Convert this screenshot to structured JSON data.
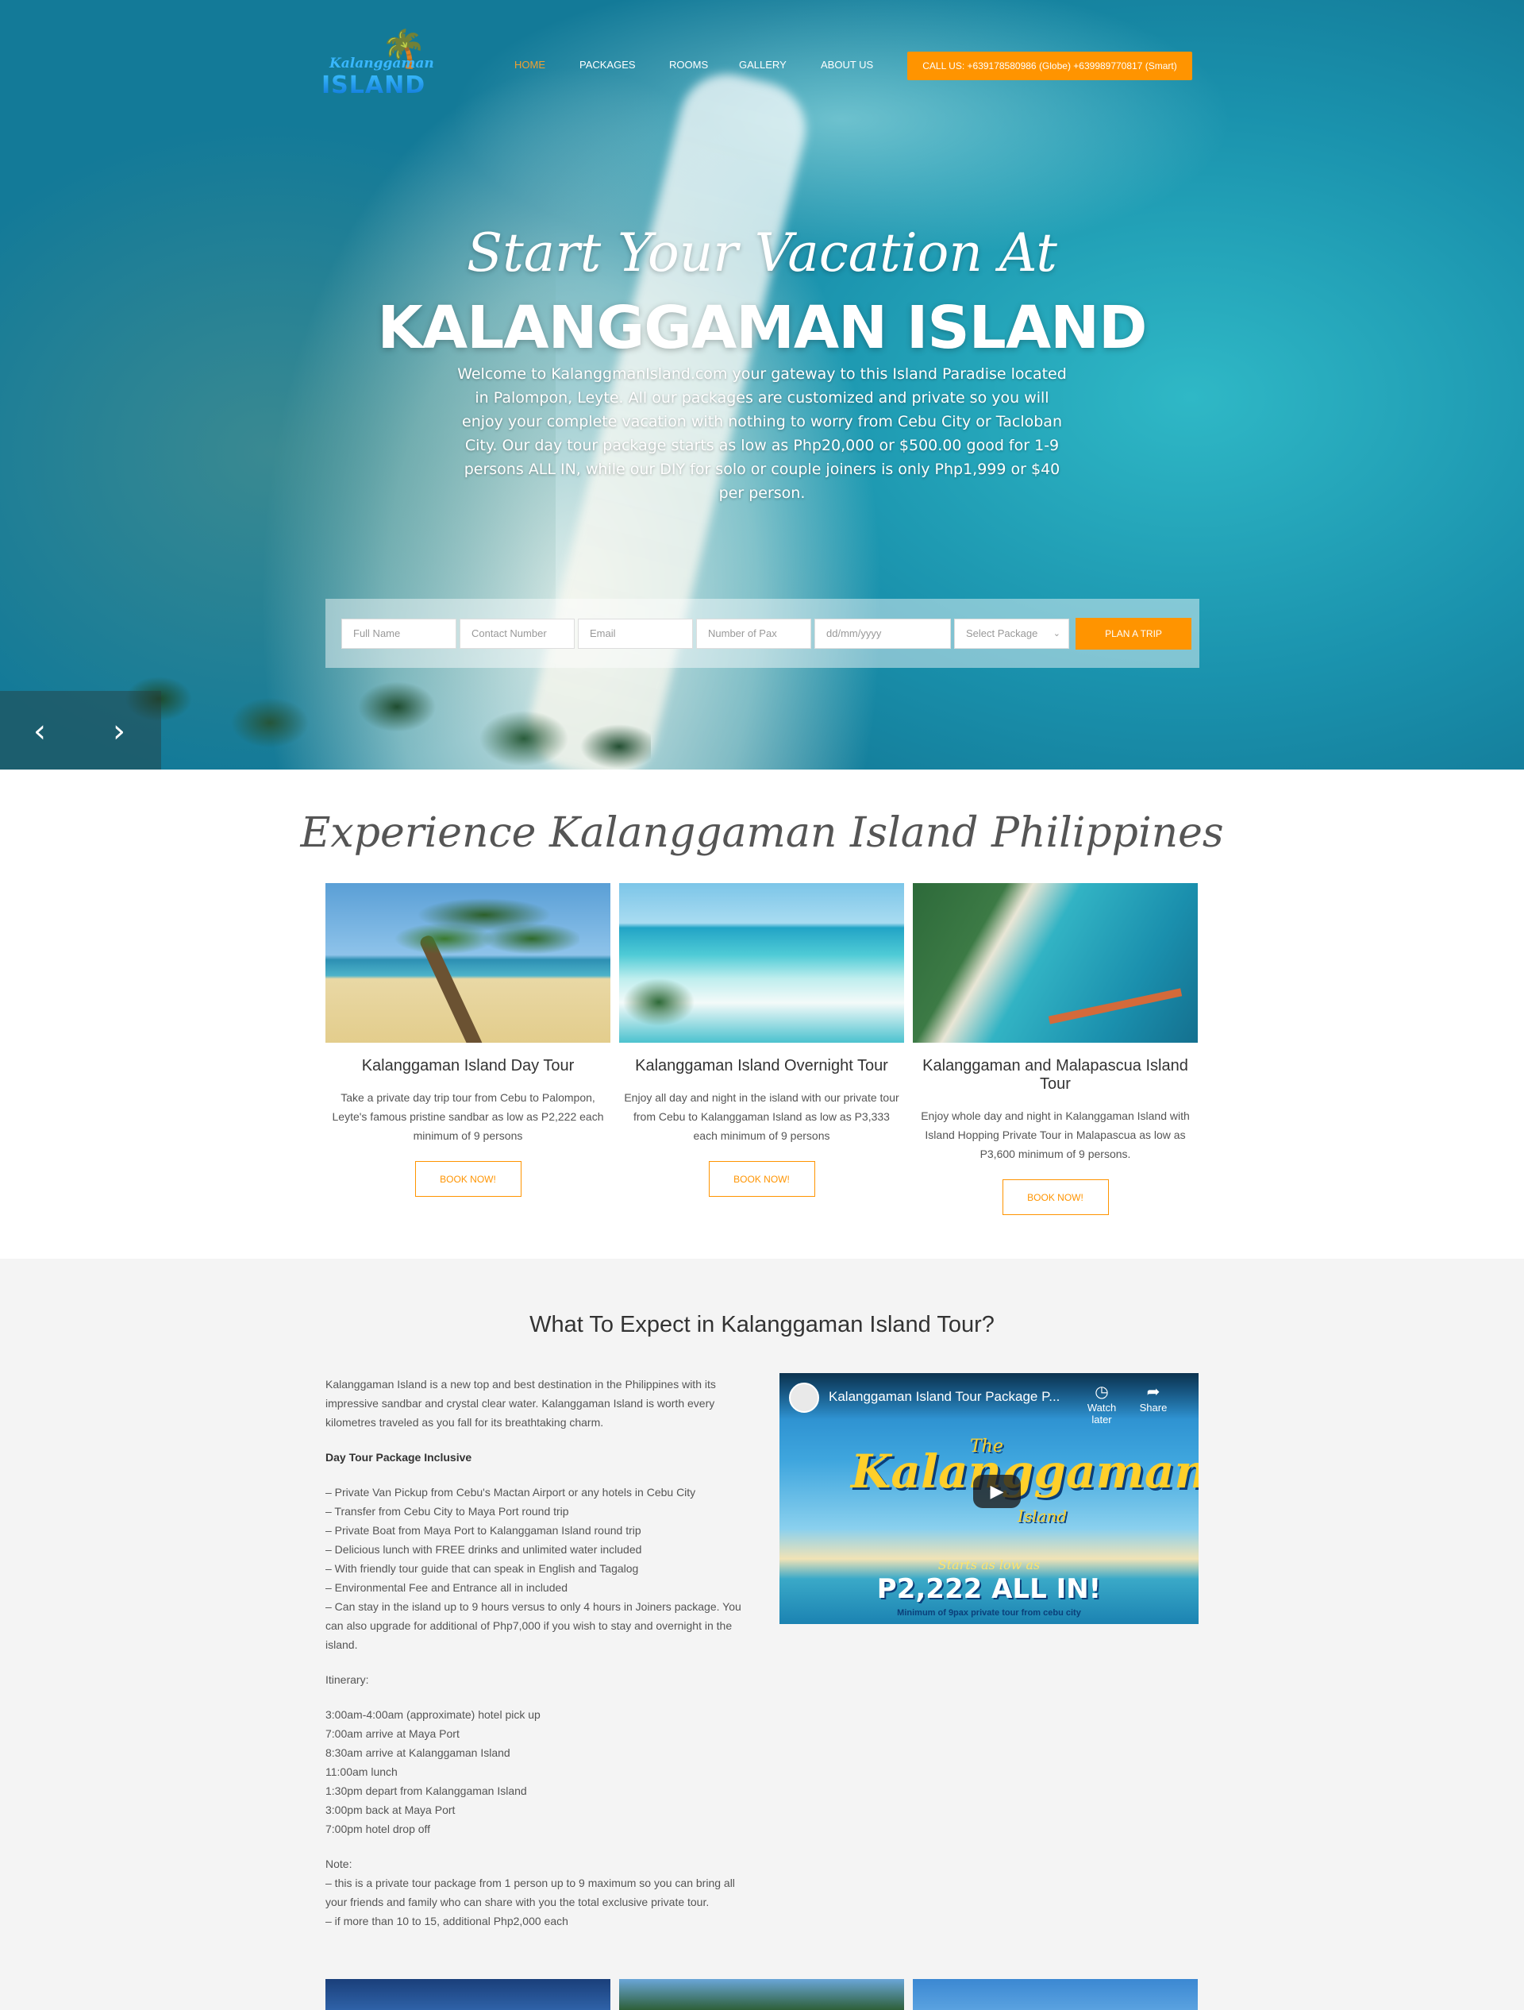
{
  "nav": {
    "logo_line1": "Kalanggaman",
    "logo_line2": "ISLAND",
    "items": [
      {
        "label": "HOME",
        "active": true
      },
      {
        "label": "PACKAGES"
      },
      {
        "label": "ROOMS"
      },
      {
        "label": "GALLERY"
      },
      {
        "label": "ABOUT US"
      }
    ],
    "call": "CALL US: +639178580986 (Globe) +639989770817 (Smart)"
  },
  "hero": {
    "script": "Start Your Vacation At",
    "title": "KALANGGAMAN ISLAND",
    "description": "Welcome to KalanggmanIsland.com your gateway to this Island Paradise located in Palompon, Leyte. All our packages are customized and private so you will enjoy your complete vacation with nothing to worry from Cebu City or Tacloban City. Our day tour package starts as low as Php20,000 or $500.00 good for 1-9 persons ALL IN, while our DIY for solo or couple joiners is only Php1,999 or $40 per person.",
    "prev_icon": "‹",
    "next_icon": "›"
  },
  "booking": {
    "full_name": "Full Name",
    "contact": "Contact Number",
    "email": "Email",
    "pax": "Number of Pax",
    "date": "dd/mm/yyyy",
    "package": "Select Package",
    "submit": "PLAN A TRIP"
  },
  "experience": {
    "heading": "Experience Kalanggaman Island Philippines",
    "cards": [
      {
        "title": "Kalanggaman Island Day Tour",
        "text": "Take a private day trip tour from Cebu to Palompon, Leyte's famous pristine sandbar as low as P2,222 each minimum of 9 persons",
        "button": "BOOK NOW!"
      },
      {
        "title": "Kalanggaman Island Overnight Tour",
        "text": "Enjoy all day and night in the island with our private tour from Cebu to Kalanggaman Island as low as P3,333 each minimum of 9 persons",
        "button": "BOOK NOW!"
      },
      {
        "title": "Kalanggaman and Malapascua Island Tour",
        "text": "Enjoy whole day and night in Kalanggaman Island with Island Hopping Private Tour in Malapascua as low as P3,600 minimum of 9 persons.",
        "button": "BOOK NOW!"
      }
    ]
  },
  "expect": {
    "heading": "What To Expect in Kalanggaman Island Tour?",
    "intro": "Kalanggaman Island is a new top and best destination in the Philippines with its impressive sandbar and crystal clear water. Kalanggaman Island is worth every kilometres traveled as you fall for its breathtaking charm.",
    "inclusive_heading": "Day Tour Package Inclusive",
    "inclusive": [
      "– Private Van Pickup from Cebu's Mactan Airport or any hotels in Cebu City",
      "– Transfer from Cebu City to Maya Port round trip",
      "– Private Boat from Maya Port to Kalanggaman Island round trip",
      "– Delicious lunch with FREE drinks and unlimited water included",
      "– With friendly tour guide that can speak in English and Tagalog",
      "– Environmental Fee and Entrance all in included",
      "– Can stay in the island up to 9 hours versus to only 4 hours in Joiners package. You can also upgrade for additional of Php7,000 if you wish to stay and overnight in the island."
    ],
    "itinerary_heading": "Itinerary:",
    "itinerary": [
      "3:00am-4:00am (approximate) hotel pick up",
      "7:00am arrive at Maya Port",
      "8:30am arrive at Kalanggaman Island",
      "11:00am lunch",
      "1:30pm depart from Kalanggaman Island",
      "3:00pm back at Maya Port",
      "7:00pm hotel drop off"
    ],
    "note_heading": "Note:",
    "notes": [
      "– this is a private tour package from 1 person up to 9 maximum so you can bring all your friends and family who can share with you the total exclusive private tour.",
      "– if more than 10 to 15, additional Php2,000 each"
    ]
  },
  "video": {
    "title": "Kalanggaman Island Tour Package P...",
    "watch_later": "Watch later",
    "share": "Share",
    "the": "The",
    "brand": "Kalanggaman",
    "brand_sub": "Island",
    "starts": "Starts as low as",
    "price": "P2,222 ALL IN!",
    "minimum": "Minimum of 9pax private tour from cebu city"
  },
  "colors": {
    "accent": "#ff9400",
    "nav_active": "#f0a030"
  }
}
